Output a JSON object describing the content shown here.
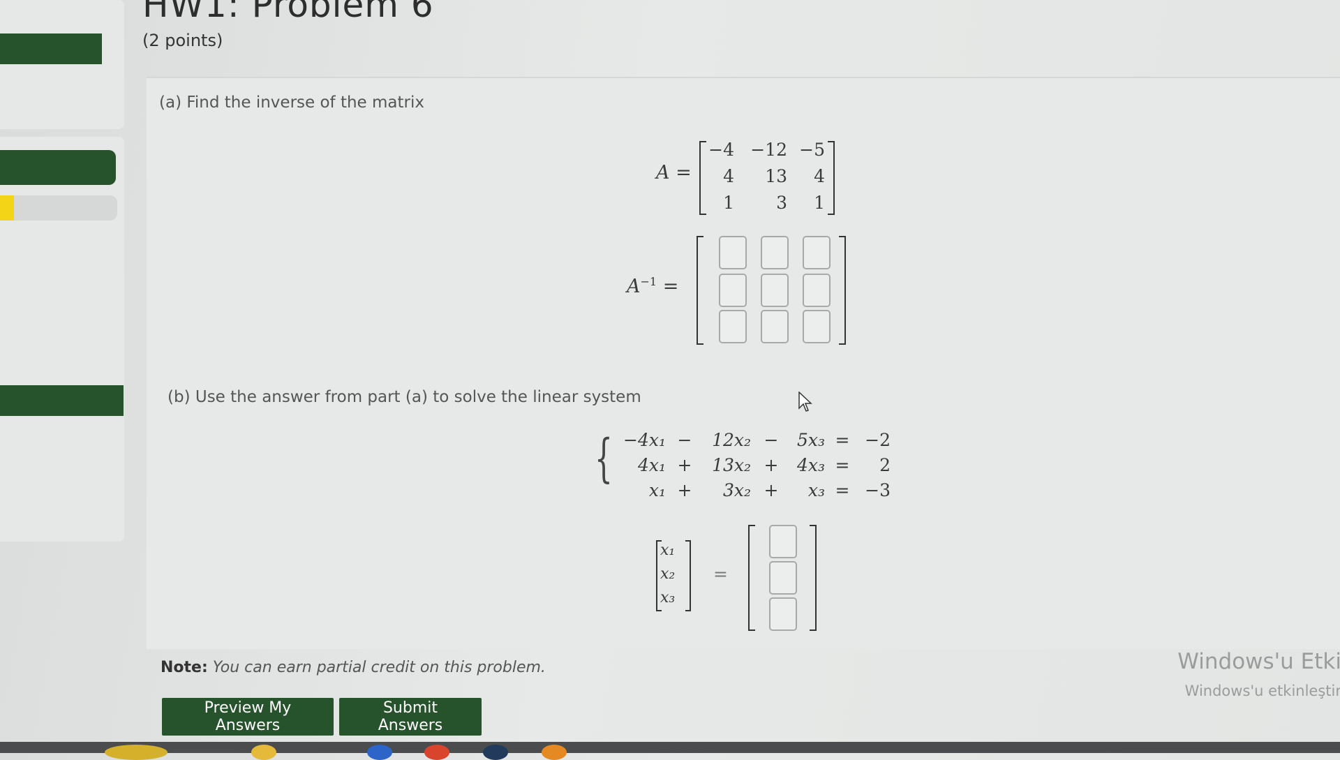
{
  "page": {
    "title": "HW1: Problem 6",
    "points": "(2 points)"
  },
  "progress": {
    "fraction": 0.12,
    "fill_color": "#f4d417"
  },
  "part_a": {
    "prompt": "(a) Find the inverse of the matrix",
    "matrix_label": "A =",
    "matrix": [
      [
        "−4",
        "−12",
        "−5"
      ],
      [
        "4",
        "13",
        "4"
      ],
      [
        "1",
        "3",
        "1"
      ]
    ],
    "inverse_label": "A",
    "inverse_sup": "−1",
    "inverse_eq": "="
  },
  "part_b": {
    "prompt": "(b) Use the answer from part (a) to solve the linear system",
    "system": [
      [
        "−4x₁",
        "−",
        "12x₂",
        "−",
        "5x₃",
        "=",
        "−2"
      ],
      [
        "4x₁",
        "+",
        "13x₂",
        "+",
        "4x₃",
        "=",
        "2"
      ],
      [
        "x₁",
        "+",
        "3x₂",
        "+",
        "x₃",
        "=",
        "−3"
      ]
    ],
    "vector": [
      "x₁",
      "x₂",
      "x₃"
    ],
    "eq": "="
  },
  "note": {
    "label": "Note:",
    "text": "You can earn partial credit on this problem."
  },
  "buttons": {
    "preview": "Preview My Answers",
    "submit": "Submit Answers"
  },
  "watermark": {
    "line1": "Windows'u Etki",
    "line2": "Windows'u etkinleştir"
  },
  "colors": {
    "accent": "#27532c"
  }
}
